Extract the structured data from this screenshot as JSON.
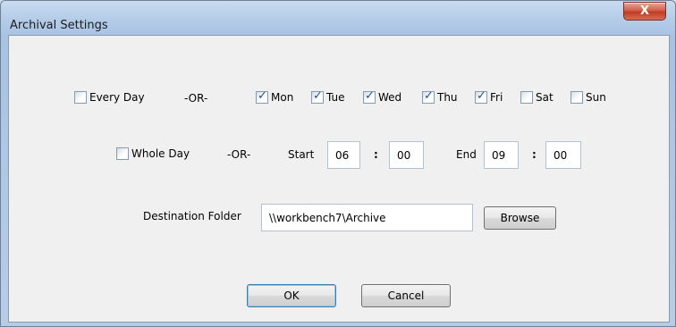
{
  "window": {
    "title": "Archival Settings",
    "close_glyph": "X"
  },
  "schedule": {
    "every_day": {
      "label": "Every Day",
      "checked": false
    },
    "or_label_1": "-OR-",
    "days": [
      {
        "label": "Mon",
        "checked": true
      },
      {
        "label": "Tue",
        "checked": true
      },
      {
        "label": "Wed",
        "checked": true
      },
      {
        "label": "Thu",
        "checked": true
      },
      {
        "label": "Fri",
        "checked": true
      },
      {
        "label": "Sat",
        "checked": false
      },
      {
        "label": "Sun",
        "checked": false
      }
    ]
  },
  "time": {
    "whole_day": {
      "label": "Whole Day",
      "checked": false
    },
    "or_label_2": "-OR-",
    "start_label": "Start",
    "start_hour": "06",
    "start_minute": "00",
    "end_label": "End",
    "end_hour": "09",
    "end_minute": "00",
    "separator": ":"
  },
  "destination": {
    "label": "Destination Folder",
    "path": "\\\\workbench7\\Archive",
    "browse_label": "Browse"
  },
  "actions": {
    "ok_label": "OK",
    "cancel_label": "Cancel"
  }
}
